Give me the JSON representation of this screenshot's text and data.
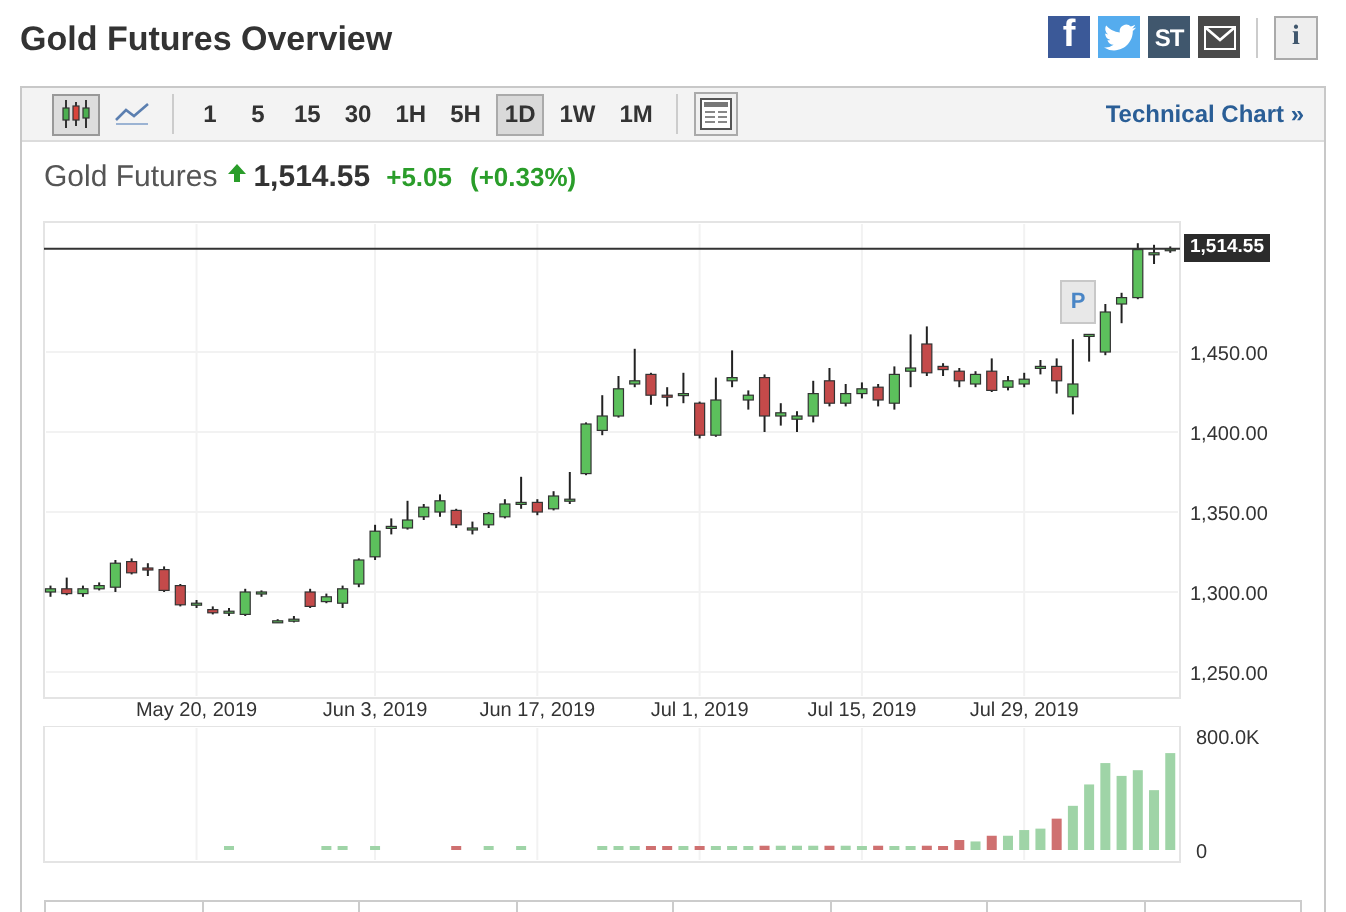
{
  "page": {
    "title": "Gold Futures Overview"
  },
  "share_buttons": [
    {
      "kind": "facebook",
      "glyph": "f"
    },
    {
      "kind": "twitter"
    },
    {
      "kind": "stocktwits",
      "glyph": "ST"
    },
    {
      "kind": "email"
    }
  ],
  "info_button": {
    "glyph": "i"
  },
  "toolbar": {
    "chart_types": [
      {
        "kind": "candles",
        "selected": true
      },
      {
        "kind": "line",
        "selected": false
      }
    ],
    "intervals": [
      {
        "label": "1",
        "selected": false
      },
      {
        "label": "5",
        "selected": false
      },
      {
        "label": "15",
        "selected": false
      },
      {
        "label": "30",
        "selected": false
      },
      {
        "label": "1H",
        "selected": false
      },
      {
        "label": "5H",
        "selected": false
      },
      {
        "label": "1D",
        "selected": true
      },
      {
        "label": "1W",
        "selected": false
      },
      {
        "label": "1M",
        "selected": false
      }
    ],
    "link": "Technical Chart »"
  },
  "quote": {
    "name": "Gold Futures",
    "rising": true,
    "price": "1,514.55",
    "change": "+5.05",
    "change_percent": "(+0.33%)"
  },
  "price_chart": {
    "marker": "P",
    "chart_data": {
      "type": "candlestick",
      "grid": true,
      "ylim": [
        1233.75,
        1531.25
      ],
      "ref_lines": [
        {
          "axis": "y",
          "value": 1514.55,
          "label": "1,514.55"
        }
      ],
      "categories": [
        null,
        null,
        null,
        null,
        null,
        null,
        null,
        null,
        null,
        "May 20, 2019",
        null,
        null,
        null,
        null,
        null,
        null,
        null,
        null,
        null,
        null,
        "Jun 3, 2019",
        null,
        null,
        null,
        null,
        null,
        null,
        null,
        null,
        null,
        "Jun 17, 2019",
        null,
        null,
        null,
        null,
        null,
        null,
        null,
        null,
        null,
        "Jul 1, 2019",
        null,
        null,
        null,
        null,
        null,
        null,
        null,
        null,
        null,
        "Jul 15, 2019",
        null,
        null,
        null,
        null,
        null,
        null,
        null,
        null,
        null,
        "Jul 29, 2019",
        null,
        null,
        null,
        null,
        null,
        null,
        null,
        null,
        null
      ],
      "ohlc": [
        [
          1300,
          1304,
          1297,
          1302
        ],
        [
          1302,
          1309,
          1298,
          1299
        ],
        [
          1299,
          1304,
          1297,
          1302
        ],
        [
          1302,
          1306,
          1301,
          1304
        ],
        [
          1303,
          1320,
          1300,
          1318
        ],
        [
          1319,
          1321,
          1311,
          1312
        ],
        [
          1315,
          1318,
          1310,
          1314
        ],
        [
          1314,
          1316,
          1300,
          1301
        ],
        [
          1304,
          1305,
          1291,
          1292
        ],
        [
          1293,
          1295,
          1290,
          1293
        ],
        [
          1289,
          1291,
          1286,
          1287
        ],
        [
          1287,
          1290,
          1285,
          1288
        ],
        [
          1286,
          1302,
          1285,
          1300
        ],
        [
          1299,
          1301,
          1297,
          1300
        ],
        [
          1282,
          1283,
          1281,
          1282
        ],
        [
          1283,
          1285,
          1281,
          1283
        ],
        [
          1300,
          1302,
          1290,
          1291
        ],
        [
          1294,
          1299,
          1293,
          1297
        ],
        [
          1293,
          1304,
          1290,
          1302
        ],
        [
          1305,
          1321,
          1303,
          1320
        ],
        [
          1322,
          1342,
          1320,
          1338
        ],
        [
          1340,
          1346,
          1336,
          1341
        ],
        [
          1340,
          1357,
          1339,
          1345
        ],
        [
          1347,
          1355,
          1345,
          1353
        ],
        [
          1350,
          1361,
          1347,
          1357
        ],
        [
          1351,
          1352,
          1340,
          1342
        ],
        [
          1340,
          1344,
          1336,
          1340
        ],
        [
          1342,
          1350,
          1340,
          1349
        ],
        [
          1347,
          1358,
          1346,
          1355
        ],
        [
          1355,
          1372,
          1352,
          1356
        ],
        [
          1356,
          1358,
          1348,
          1350
        ],
        [
          1352,
          1363,
          1351,
          1360
        ],
        [
          1357,
          1375,
          1355,
          1358
        ],
        [
          1374,
          1406,
          1373,
          1405
        ],
        [
          1401,
          1423,
          1398,
          1410
        ],
        [
          1410,
          1435,
          1409,
          1427
        ],
        [
          1430,
          1452,
          1428,
          1432
        ],
        [
          1436,
          1437,
          1417,
          1423
        ],
        [
          1423,
          1428,
          1416,
          1422
        ],
        [
          1423,
          1437,
          1418,
          1424
        ],
        [
          1418,
          1419,
          1396,
          1398
        ],
        [
          1398,
          1434,
          1397,
          1420
        ],
        [
          1432,
          1451,
          1428,
          1434
        ],
        [
          1420,
          1426,
          1414,
          1423
        ],
        [
          1434,
          1436,
          1400,
          1410
        ],
        [
          1410,
          1418,
          1404,
          1412
        ],
        [
          1408,
          1413,
          1400,
          1410
        ],
        [
          1410,
          1432,
          1406,
          1424
        ],
        [
          1432,
          1440,
          1416,
          1418
        ],
        [
          1418,
          1430,
          1416,
          1424
        ],
        [
          1424,
          1431,
          1421,
          1427
        ],
        [
          1428,
          1430,
          1416,
          1420
        ],
        [
          1418,
          1441,
          1414,
          1436
        ],
        [
          1438,
          1461,
          1428,
          1440
        ],
        [
          1455,
          1466,
          1435,
          1437
        ],
        [
          1441,
          1443,
          1435,
          1439
        ],
        [
          1438,
          1440,
          1428,
          1432
        ],
        [
          1430,
          1438,
          1428,
          1436
        ],
        [
          1438,
          1446,
          1425,
          1426
        ],
        [
          1428,
          1435,
          1426,
          1432
        ],
        [
          1430,
          1437,
          1428,
          1433
        ],
        [
          1440,
          1445,
          1436,
          1441
        ],
        [
          1441,
          1446,
          1424,
          1432
        ],
        [
          1422,
          1458,
          1411,
          1430
        ],
        [
          1460,
          1461,
          1444,
          1461
        ],
        [
          1450,
          1480,
          1448,
          1475
        ],
        [
          1480,
          1487,
          1468,
          1484
        ],
        [
          1484,
          1518,
          1483,
          1514
        ],
        [
          1512,
          1517,
          1505,
          1512
        ],
        [
          1514,
          1516,
          1512,
          1514.55
        ]
      ],
      "yticks": [
        {
          "value": 1450,
          "label": "1,450.00"
        },
        {
          "value": 1400,
          "label": "1,400.00"
        },
        {
          "value": 1350,
          "label": "1,350.00"
        },
        {
          "value": 1300,
          "label": "1,300.00"
        },
        {
          "value": 1250,
          "label": "1,250.00"
        }
      ]
    }
  },
  "volume_chart": {
    "chart_data": {
      "type": "bar",
      "grid": true,
      "ylim": [
        -84210,
        870175
      ],
      "categories": [
        null,
        null,
        null,
        null,
        null,
        null,
        null,
        null,
        null,
        null,
        null,
        null,
        null,
        null,
        null,
        null,
        null,
        null,
        null,
        null,
        null,
        null,
        null,
        null,
        null,
        null,
        null,
        null,
        null,
        null,
        null,
        null,
        null,
        null,
        null,
        null,
        null,
        null,
        null,
        null,
        null,
        null,
        null,
        null,
        null,
        null,
        null,
        null,
        null,
        null,
        null,
        null,
        null,
        null,
        null,
        null,
        null,
        null,
        null,
        null,
        null,
        null,
        null,
        null,
        null,
        null,
        null,
        null,
        null,
        null
      ],
      "values": [
        0,
        0,
        0,
        0,
        0,
        0,
        0,
        0,
        0,
        0,
        0,
        10000,
        0,
        0,
        0,
        0,
        0,
        10000,
        10000,
        0,
        10000,
        0,
        0,
        0,
        0,
        10000,
        0,
        10000,
        0,
        10000,
        0,
        0,
        0,
        0,
        10000,
        10000,
        10000,
        10000,
        10000,
        10000,
        10000,
        10000,
        20000,
        10000,
        30000,
        30000,
        30000,
        30000,
        30000,
        30000,
        20000,
        30000,
        20000,
        20000,
        30000,
        20000,
        70000,
        60000,
        100000,
        100000,
        140000,
        150000,
        220000,
        310000,
        460000,
        610000,
        520000,
        560000,
        420000,
        680000
      ],
      "yticks": [
        {
          "value": 0,
          "label": "0"
        },
        {
          "value": 800000,
          "label": "800.0K"
        }
      ]
    }
  }
}
